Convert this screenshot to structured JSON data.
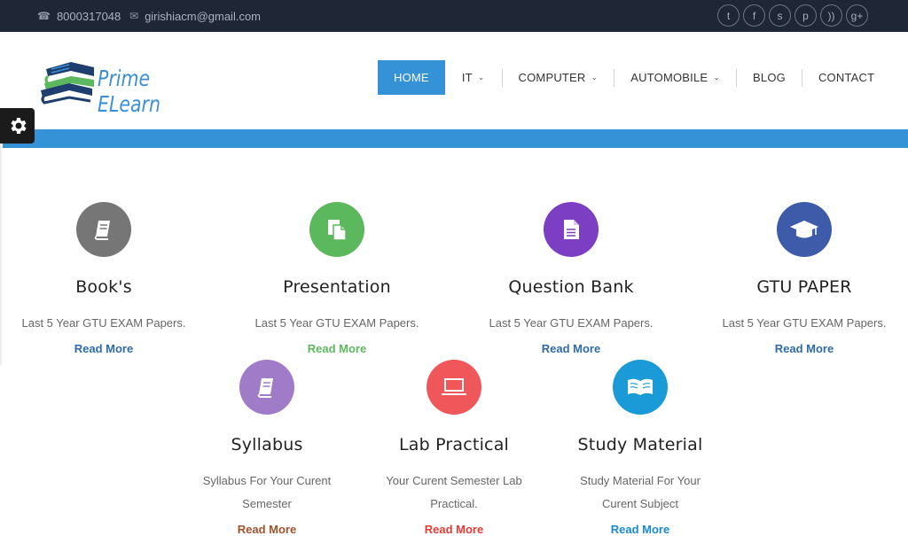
{
  "topbar": {
    "phone": "8000317048",
    "email": "girishiacm@gmail.com",
    "social": [
      "twitter-icon",
      "facebook-icon",
      "skype-icon",
      "pinterest-icon",
      "rss-icon",
      "google-plus-icon"
    ],
    "social_glyphs": [
      "t",
      "f",
      "s",
      "p",
      "))",
      "g+"
    ]
  },
  "brand": {
    "name": "Prime ELearn",
    "colors": {
      "blue": "#3b8fd6",
      "green": "#5cb85c",
      "navy": "#1e3f6e"
    }
  },
  "nav": {
    "items": [
      {
        "label": "HOME",
        "active": true,
        "dropdown": false
      },
      {
        "label": "IT",
        "active": false,
        "dropdown": true
      },
      {
        "label": "COMPUTER",
        "active": false,
        "dropdown": true
      },
      {
        "label": "AUTOMOBILE",
        "active": false,
        "dropdown": true
      },
      {
        "label": "BLOG",
        "active": false,
        "dropdown": false
      },
      {
        "label": "CONTACT",
        "active": false,
        "dropdown": false
      }
    ]
  },
  "colors": {
    "accent": "#3592d7",
    "topbar": "#1f2737"
  },
  "features": [
    {
      "title": "Book's",
      "desc": "Last 5 Year GTU EXAM Papers.",
      "more": "Read More",
      "color": "#767676",
      "link_color": "#2f6aa8",
      "icon": "book-icon"
    },
    {
      "title": "Presentation",
      "desc": "Last 5 Year GTU EXAM Papers.",
      "more": "Read More",
      "color": "#5cb85c",
      "link_color": "#5cb85c",
      "icon": "files-icon"
    },
    {
      "title": "Question Bank",
      "desc": "Last 5 Year GTU EXAM Papers.",
      "more": "Read More",
      "color": "#7c3fc4",
      "link_color": "#2f6aa8",
      "icon": "document-icon"
    },
    {
      "title": "GTU PAPER",
      "desc": "Last 5 Year GTU EXAM Papers.",
      "more": "Read More",
      "color": "#3d5ba9",
      "link_color": "#2f6aa8",
      "icon": "graduation-cap-icon"
    },
    {
      "title": "Syllabus",
      "desc": "Syllabus For Your Curent Semester",
      "more": "Read More",
      "color": "#a07cc8",
      "link_color": "#a0522d",
      "icon": "book-icon"
    },
    {
      "title": "Lab Practical",
      "desc": "Your Curent Semester Lab Practical.",
      "more": "Read More",
      "color": "#f0575a",
      "link_color": "#e53935",
      "icon": "laptop-icon"
    },
    {
      "title": "Study Material",
      "desc": "Study Material For Your Curent Subject",
      "more": "Read More",
      "color": "#1a9ad6",
      "link_color": "#1a8ad0",
      "icon": "open-book-icon"
    }
  ]
}
